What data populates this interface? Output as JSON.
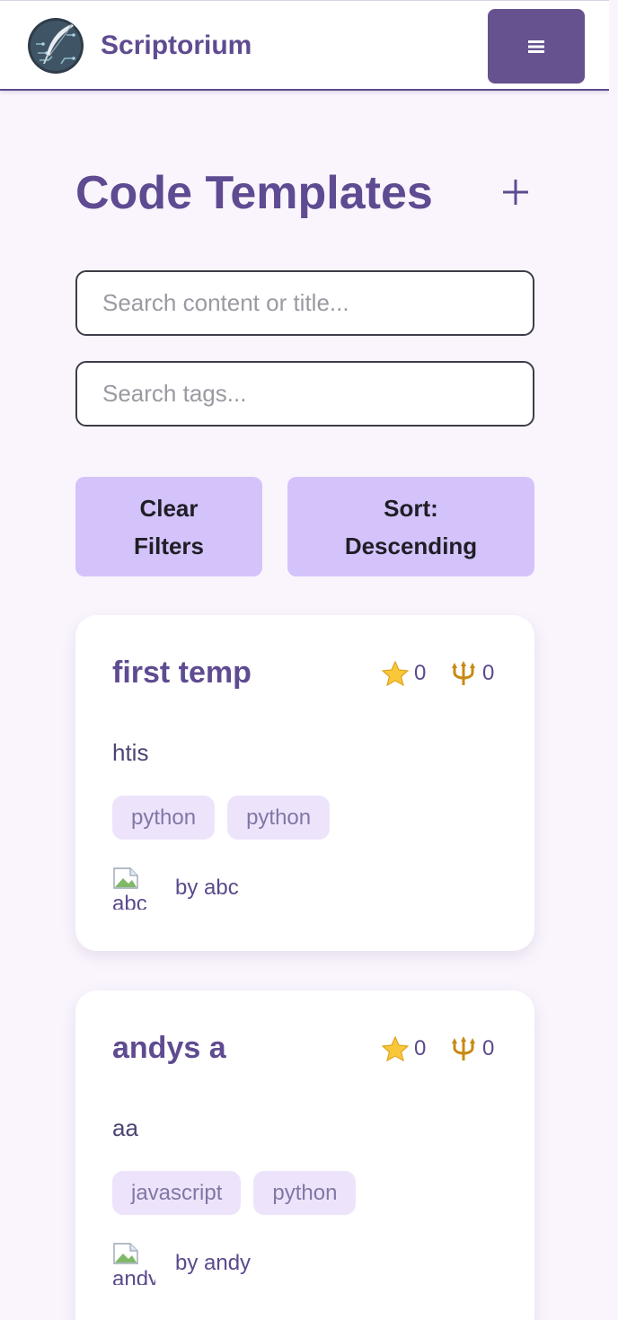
{
  "app": {
    "brand": "Scriptorium",
    "menu_icon": "hamburger-icon"
  },
  "page": {
    "title": "Code Templates",
    "add_icon": "plus-icon"
  },
  "search": {
    "content_placeholder": "Search content or title...",
    "content_value": "",
    "tags_placeholder": "Search tags...",
    "tags_value": ""
  },
  "actions": {
    "clear_label": "Clear Filters",
    "sort_label": "Sort: Descending"
  },
  "colors": {
    "brand": "#5f4b91",
    "menu_button": "#65528f",
    "action_button": "#d4c3fb",
    "tag_bg": "#ede4fc",
    "page_bg": "#faf5fd"
  },
  "templates": [
    {
      "title": "first temp",
      "stars": "0",
      "forks": "0",
      "description": "htis",
      "tags": [
        "python",
        "python"
      ],
      "avatar_alt": "abc",
      "author": "by abc"
    },
    {
      "title": "andys a",
      "stars": "0",
      "forks": "0",
      "description": "aa",
      "tags": [
        "javascript",
        "python"
      ],
      "avatar_alt": "andy",
      "author": "by andy"
    }
  ]
}
